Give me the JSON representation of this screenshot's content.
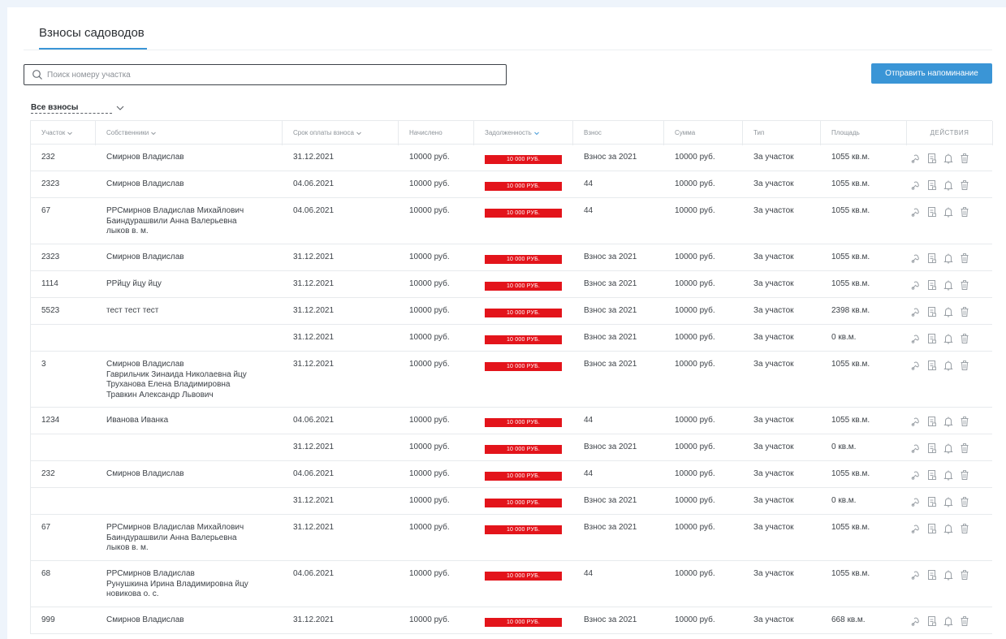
{
  "tab": {
    "label": "Взносы садоводов"
  },
  "search": {
    "placeholder": "Поиск номеру участка",
    "value": ""
  },
  "remind_button": "Отправить напоминание",
  "filter": {
    "label": "Все взносы"
  },
  "table": {
    "headers": {
      "plot": "Участок",
      "owners": "Собственники",
      "due": "Срок оплаты взноса",
      "accrued": "Начислено",
      "debt": "Задолженность",
      "fee": "Взнос",
      "sum": "Сумма",
      "type": "Тип",
      "area": "Площадь",
      "actions": "ДЕЙСТВИЯ"
    },
    "rows": [
      {
        "plot": "232",
        "owners": [
          "Смирнов Владислав"
        ],
        "due": "31.12.2021",
        "accrued": "10000 руб.",
        "debt": "10 000 РУБ.",
        "fee": "Взнос за 2021",
        "sum": "10000 руб.",
        "type": "За участок",
        "area": "1055 кв.м."
      },
      {
        "plot": "2323",
        "owners": [
          "Смирнов Владислав"
        ],
        "due": "04.06.2021",
        "accrued": "10000 руб.",
        "debt": "10 000 РУБ.",
        "fee": "44",
        "sum": "10000 руб.",
        "type": "За участок",
        "area": "1055 кв.м."
      },
      {
        "plot": "67",
        "owners": [
          "РРСмирнов Владислав Михайлович",
          "Баиндурашвили Анна Валерьевна",
          "лыков в. м."
        ],
        "due": "04.06.2021",
        "accrued": "10000 руб.",
        "debt": "10 000 РУБ.",
        "fee": "44",
        "sum": "10000 руб.",
        "type": "За участок",
        "area": "1055 кв.м."
      },
      {
        "plot": "2323",
        "owners": [
          "Смирнов Владислав"
        ],
        "due": "31.12.2021",
        "accrued": "10000 руб.",
        "debt": "10 000 РУБ.",
        "fee": "Взнос за 2021",
        "sum": "10000 руб.",
        "type": "За участок",
        "area": "1055 кв.м."
      },
      {
        "plot": "1114",
        "owners": [
          "РРйцу йцу йцу"
        ],
        "due": "31.12.2021",
        "accrued": "10000 руб.",
        "debt": "10 000 РУБ.",
        "fee": "Взнос за 2021",
        "sum": "10000 руб.",
        "type": "За участок",
        "area": "1055 кв.м."
      },
      {
        "plot": "5523",
        "owners": [
          "тест тест тест"
        ],
        "due": "31.12.2021",
        "accrued": "10000 руб.",
        "debt": "10 000 РУБ.",
        "fee": "Взнос за 2021",
        "sum": "10000 руб.",
        "type": "За участок",
        "area": "2398 кв.м."
      },
      {
        "plot": "",
        "owners": [],
        "due": "31.12.2021",
        "accrued": "10000 руб.",
        "debt": "10 000 РУБ.",
        "fee": "Взнос за 2021",
        "sum": "10000 руб.",
        "type": "За участок",
        "area": "0 кв.м."
      },
      {
        "plot": "3",
        "owners": [
          "Смирнов Владислав",
          "Гаврильчик Зинаида Николаевна йцу",
          "Труханова Елена Владимировна",
          "Травкин Александр Львович"
        ],
        "due": "31.12.2021",
        "accrued": "10000 руб.",
        "debt": "10 000 РУБ.",
        "fee": "Взнос за 2021",
        "sum": "10000 руб.",
        "type": "За участок",
        "area": "1055 кв.м."
      },
      {
        "plot": "1234",
        "owners": [
          "Иванова Иванка"
        ],
        "due": "04.06.2021",
        "accrued": "10000 руб.",
        "debt": "10 000 РУБ.",
        "fee": "44",
        "sum": "10000 руб.",
        "type": "За участок",
        "area": "1055 кв.м."
      },
      {
        "plot": "",
        "owners": [],
        "due": "31.12.2021",
        "accrued": "10000 руб.",
        "debt": "10 000 РУБ.",
        "fee": "Взнос за 2021",
        "sum": "10000 руб.",
        "type": "За участок",
        "area": "0 кв.м."
      },
      {
        "plot": "232",
        "owners": [
          "Смирнов Владислав"
        ],
        "due": "04.06.2021",
        "accrued": "10000 руб.",
        "debt": "10 000 РУБ.",
        "fee": "44",
        "sum": "10000 руб.",
        "type": "За участок",
        "area": "1055 кв.м."
      },
      {
        "plot": "",
        "owners": [],
        "due": "31.12.2021",
        "accrued": "10000 руб.",
        "debt": "10 000 РУБ.",
        "fee": "Взнос за 2021",
        "sum": "10000 руб.",
        "type": "За участок",
        "area": "0 кв.м."
      },
      {
        "plot": "67",
        "owners": [
          "РРСмирнов Владислав Михайлович",
          "Баиндурашвили Анна Валерьевна",
          "лыков в. м."
        ],
        "due": "31.12.2021",
        "accrued": "10000 руб.",
        "debt": "10 000 РУБ.",
        "fee": "Взнос за 2021",
        "sum": "10000 руб.",
        "type": "За участок",
        "area": "1055 кв.м."
      },
      {
        "plot": "68",
        "owners": [
          "РРСмирнов Владислав",
          "Рунушкина Ирина Владимировна йцу",
          "новикова о. с."
        ],
        "due": "04.06.2021",
        "accrued": "10000 руб.",
        "debt": "10 000 РУБ.",
        "fee": "44",
        "sum": "10000 руб.",
        "type": "За участок",
        "area": "1055 кв.м."
      },
      {
        "plot": "999",
        "owners": [
          "Смирнов Владислав"
        ],
        "due": "31.12.2021",
        "accrued": "10000 руб.",
        "debt": "10 000 РУБ.",
        "fee": "Взнос за 2021",
        "sum": "10000 руб.",
        "type": "За участок",
        "area": "668 кв.м."
      }
    ]
  },
  "icons": [
    "pay-icon",
    "document-icon",
    "bell-icon",
    "trash-icon"
  ],
  "colors": {
    "accent": "#3a95d6",
    "debt_badge": "#e3141b"
  }
}
